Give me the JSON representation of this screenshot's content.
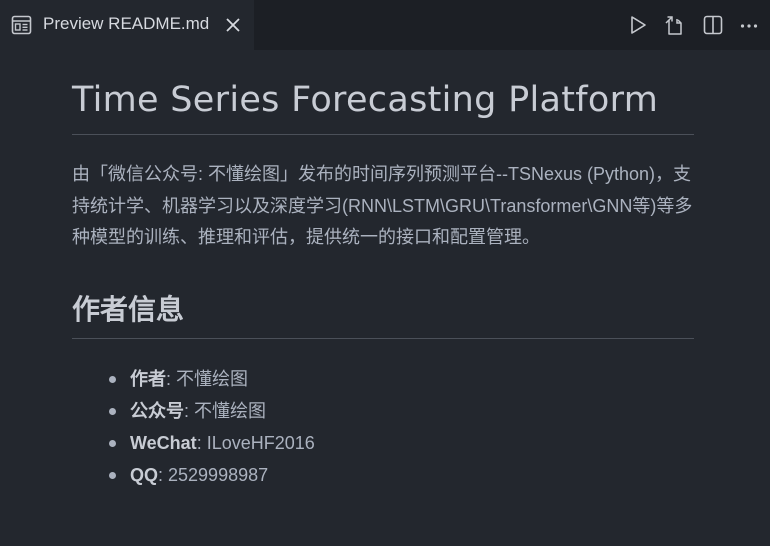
{
  "tab": {
    "title": "Preview README.md",
    "preview_icon": "preview-icon",
    "close_icon": "close-icon"
  },
  "actions": [
    {
      "name": "run-button",
      "icon": "play-icon"
    },
    {
      "name": "open-source-button",
      "icon": "open-file-icon"
    },
    {
      "name": "split-editor-button",
      "icon": "split-editor-icon"
    },
    {
      "name": "more-actions-button",
      "icon": "ellipsis-icon"
    }
  ],
  "doc": {
    "title": "Time Series Forecasting Platform",
    "description": "由「微信公众号: 不懂绘图」发布的时间序列预测平台--TSNexus (Python)，支持统计学、机器学习以及深度学习(RNN\\LSTM\\GRU\\Transformer\\GNN等)等多种模型的训练、推理和评估，提供统一的接口和配置管理。",
    "section_title": "作者信息",
    "items": [
      {
        "key": "作者",
        "value": ": 不懂绘图"
      },
      {
        "key": "公众号",
        "value": ": 不懂绘图"
      },
      {
        "key": "WeChat",
        "value": ": ILoveHF2016"
      },
      {
        "key": "QQ",
        "value": ": 2529998987"
      }
    ]
  },
  "colors": {
    "background": "#23272e",
    "tabbar": "#1c1f25",
    "heading": "#c8ccd4",
    "text": "#abb2bf",
    "rule": "#4b5059"
  }
}
